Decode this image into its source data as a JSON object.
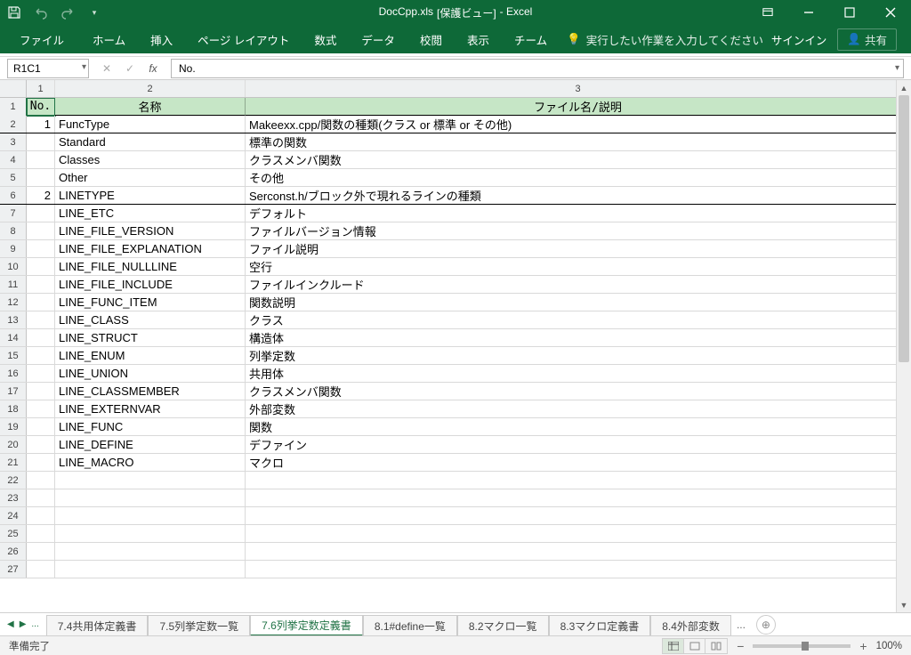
{
  "title": {
    "file": "DocCpp.xls",
    "suffix": "[保護ビュー]",
    "app": "- Excel"
  },
  "ribbon": {
    "tabs": [
      "ファイル",
      "ホーム",
      "挿入",
      "ページ レイアウト",
      "数式",
      "データ",
      "校閲",
      "表示",
      "チーム"
    ],
    "tell_me": "実行したい作業を入力してください",
    "signin": "サインイン",
    "share": "共有"
  },
  "formula_bar": {
    "name_box": "R1C1",
    "value": "No."
  },
  "columns": [
    "1",
    "2",
    "3"
  ],
  "header_row": {
    "no": "No.",
    "name": "名称",
    "desc": "ファイル名/説明"
  },
  "rows": [
    {
      "no": "1",
      "name": "FuncType",
      "desc": "Makeexx.cpp/関数の種類(クラス or 標準 or その他)",
      "group": true
    },
    {
      "no": "",
      "name": "Standard",
      "desc": "標準の関数"
    },
    {
      "no": "",
      "name": "Classes",
      "desc": "クラスメンバ関数"
    },
    {
      "no": "",
      "name": "Other",
      "desc": "その他"
    },
    {
      "no": "2",
      "name": "LINETYPE",
      "desc": "Serconst.h/ブロック外で現れるラインの種類",
      "group": true
    },
    {
      "no": "",
      "name": "LINE_ETC",
      "desc": "デフォルト"
    },
    {
      "no": "",
      "name": "LINE_FILE_VERSION",
      "desc": "ファイルバージョン情報"
    },
    {
      "no": "",
      "name": "LINE_FILE_EXPLANATION",
      "desc": "ファイル説明"
    },
    {
      "no": "",
      "name": "LINE_FILE_NULLLINE",
      "desc": "空行"
    },
    {
      "no": "",
      "name": "LINE_FILE_INCLUDE",
      "desc": "ファイルインクルード"
    },
    {
      "no": "",
      "name": "LINE_FUNC_ITEM",
      "desc": "関数説明"
    },
    {
      "no": "",
      "name": "LINE_CLASS",
      "desc": "クラス"
    },
    {
      "no": "",
      "name": "LINE_STRUCT",
      "desc": "構造体"
    },
    {
      "no": "",
      "name": "LINE_ENUM",
      "desc": "列挙定数"
    },
    {
      "no": "",
      "name": "LINE_UNION",
      "desc": "共用体"
    },
    {
      "no": "",
      "name": "LINE_CLASSMEMBER",
      "desc": "クラスメンバ関数"
    },
    {
      "no": "",
      "name": "LINE_EXTERNVAR",
      "desc": "外部変数"
    },
    {
      "no": "",
      "name": "LINE_FUNC",
      "desc": "関数"
    },
    {
      "no": "",
      "name": "LINE_DEFINE",
      "desc": "デファイン"
    },
    {
      "no": "",
      "name": "LINE_MACRO",
      "desc": "マクロ"
    },
    {
      "no": "",
      "name": "",
      "desc": ""
    },
    {
      "no": "",
      "name": "",
      "desc": ""
    },
    {
      "no": "",
      "name": "",
      "desc": ""
    },
    {
      "no": "",
      "name": "",
      "desc": ""
    },
    {
      "no": "",
      "name": "",
      "desc": ""
    },
    {
      "no": "",
      "name": "",
      "desc": ""
    }
  ],
  "sheets": {
    "ellipsis": "...",
    "tabs": [
      "7.4共用体定義書",
      "7.5列挙定数一覧",
      "7.6列挙定数定義書",
      "8.1#define一覧",
      "8.2マクロ一覧",
      "8.3マクロ定義書",
      "8.4外部変数"
    ],
    "active": 2,
    "trail": "..."
  },
  "status": {
    "ready": "準備完了",
    "zoom": "100%"
  }
}
